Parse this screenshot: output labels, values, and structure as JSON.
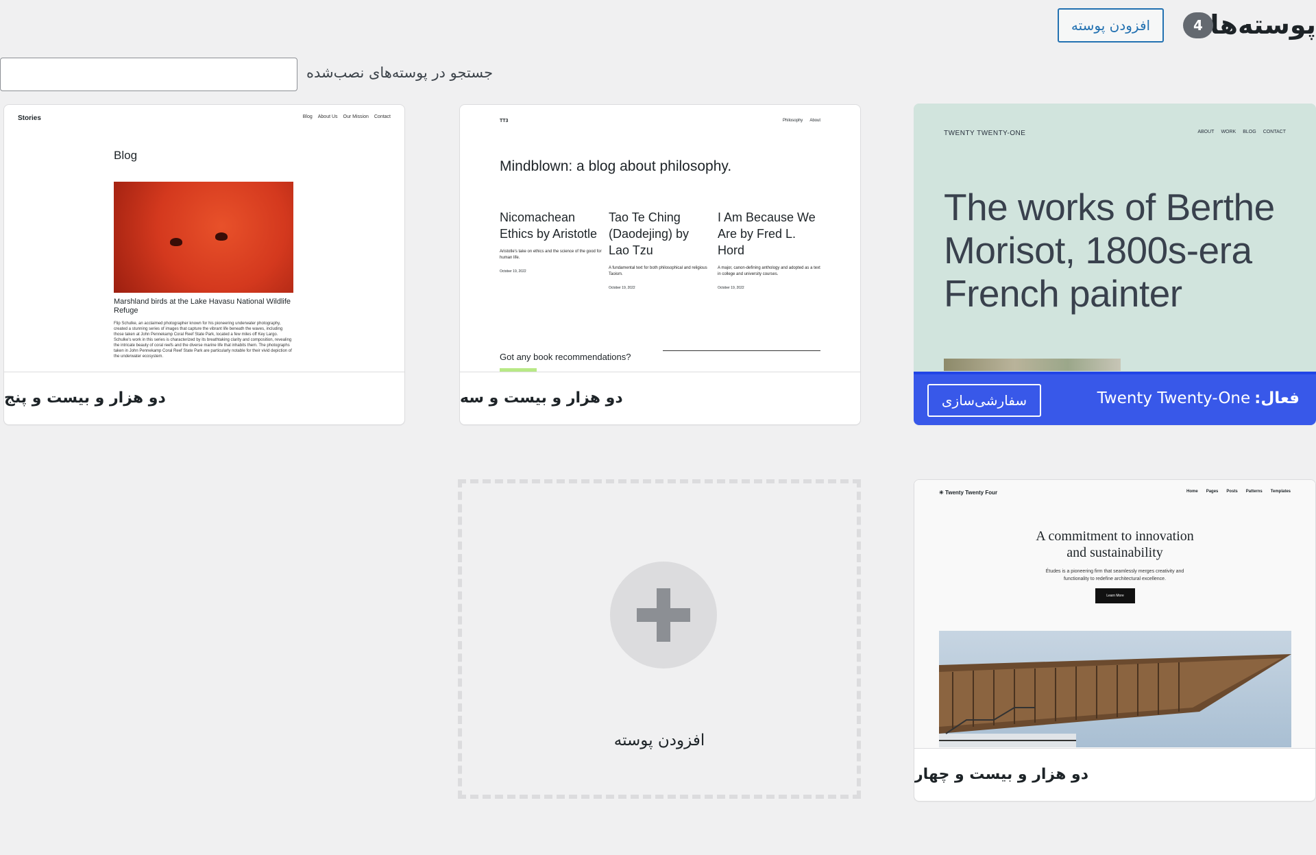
{
  "header": {
    "title": "پوسته‌ها",
    "count": "4",
    "add_button": "افزودن پوسته"
  },
  "search": {
    "label": "جستجو در پوسته‌های نصب‌شده",
    "placeholder": ""
  },
  "themes": [
    {
      "name": "دو هزار و بیست و پنج",
      "preview": {
        "brand": "Stories",
        "nav": [
          "Blog",
          "About Us",
          "Our Mission",
          "Contact"
        ],
        "heading": "Blog",
        "caption": "Marshland birds at the Lake Havasu National Wildlife Refuge",
        "text": "Flip Schulke, an acclaimed photographer known for his pioneering underwater photography, created a stunning series of images that capture the vibrant life beneath the waves, including those taken at John Pennekamp Coral Reef State Park, located a few miles off Key Largo. Schulke's work in this series is characterized by its breathtaking clarity and composition, revealing the intricate beauty of coral reefs and the diverse marine life that inhabits them. The photographs taken in John Pennekamp Coral Reef State Park are particularly notable for their vivid depiction of the underwater ecosystem."
      }
    },
    {
      "name": "دو هزار و بیست و سه",
      "preview": {
        "brand": "TT3",
        "nav": [
          "Philosophy",
          "About"
        ],
        "tagline": "Mindblown: a blog about philosophy.",
        "posts": [
          {
            "title": "Nicomachean Ethics by Aristotle",
            "excerpt": "Aristotle's take on ethics and the science of the good for human life.",
            "date": "October 19, 2022"
          },
          {
            "title": "Tao Te Ching (Daodejing) by Lao Tzu",
            "excerpt": "A fundamental text for both philosophical and religious Taoism.",
            "date": "October 19, 2022"
          },
          {
            "title": "I Am Because We Are by Fred L. Hord",
            "excerpt": "A major, canon-defining anthology and adopted as a text in college and university courses.",
            "date": "October 19, 2022"
          }
        ],
        "recommend": "Got any book recommendations?"
      }
    },
    {
      "name": "Twenty Twenty-One",
      "active_prefix": "فعال:",
      "customize": "سفارشی‌سازی",
      "preview": {
        "brand": "TWENTY TWENTY-ONE",
        "nav": [
          "ABOUT",
          "WORK",
          "BLOG",
          "CONTACT"
        ],
        "headline": "The works of Berthe Morisot, 1800s-era French painter"
      }
    },
    {
      "name": "دو هزار و بیست و چهار",
      "preview": {
        "brand": "Twenty Twenty Four",
        "nav": [
          "Home",
          "Pages",
          "Posts",
          "Patterns",
          "Templates"
        ],
        "headline": "A commitment to innovation and sustainability",
        "sub": "Études is a pioneering firm that seamlessly merges creativity and functionality to redefine architectural excellence.",
        "button": "Learn More"
      }
    }
  ],
  "add_card": {
    "label": "افزودن پوسته"
  },
  "colors": {
    "accent": "#3858e9",
    "link": "#2271b1",
    "background": "#f0f0f1"
  }
}
